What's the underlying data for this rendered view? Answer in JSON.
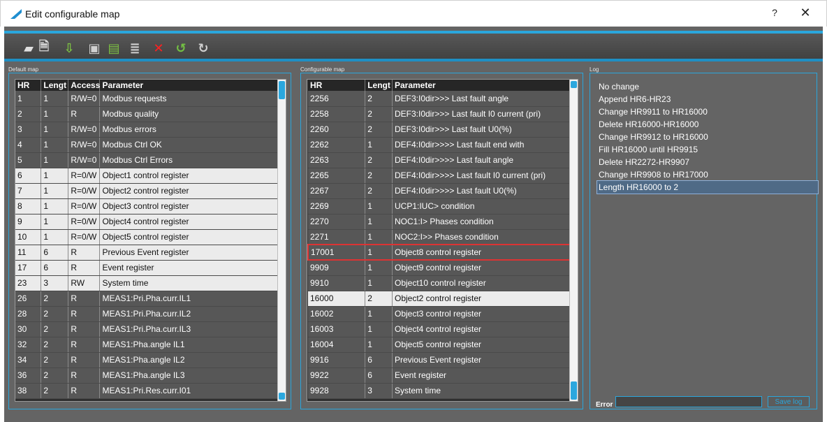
{
  "window": {
    "title": "Edit configurable map",
    "help_label": "?",
    "close_label": "✕"
  },
  "toolbar": {
    "buttons": [
      {
        "name": "open-folder-icon",
        "glyph": "▰",
        "color": "#e0e0e0"
      },
      {
        "name": "preview-document-icon",
        "glyph": "🗎",
        "color": "#d9d9d9"
      },
      {
        "name": "import-icon",
        "glyph": "⇩",
        "color": "#7cc043"
      },
      {
        "name": "save-icon",
        "glyph": "▣",
        "color": "#d0d0d0"
      },
      {
        "name": "export-icon",
        "glyph": "▤",
        "color": "#7cc043"
      },
      {
        "name": "list-icon",
        "glyph": "≣",
        "color": "#d0d0d0"
      },
      {
        "name": "delete-icon",
        "glyph": "✕",
        "color": "#ff2020"
      },
      {
        "name": "undo-icon",
        "glyph": "↺",
        "color": "#73c043"
      },
      {
        "name": "redo-icon",
        "glyph": "↻",
        "color": "#d0d0d0"
      }
    ]
  },
  "default_map": {
    "label": "Default map",
    "headers": [
      "HR",
      "Lengt",
      "Access",
      "Parameter"
    ],
    "rows": [
      [
        "1",
        "1",
        "R/W=0",
        "Modbus requests",
        "dark"
      ],
      [
        "2",
        "1",
        "R",
        "Modbus quality",
        "dark"
      ],
      [
        "3",
        "1",
        "R/W=0",
        "Modbus errors",
        "dark"
      ],
      [
        "4",
        "1",
        "R/W=0",
        "Modbus Ctrl OK",
        "dark"
      ],
      [
        "5",
        "1",
        "R/W=0",
        "Modbus Ctrl Errors",
        "dark"
      ],
      [
        "6",
        "1",
        "R=0/W",
        "Object1 control register",
        "light"
      ],
      [
        "7",
        "1",
        "R=0/W",
        "Object2 control register",
        "light"
      ],
      [
        "8",
        "1",
        "R=0/W",
        "Object3 control register",
        "light"
      ],
      [
        "9",
        "1",
        "R=0/W",
        "Object4 control register",
        "light"
      ],
      [
        "10",
        "1",
        "R=0/W",
        "Object5 control register",
        "light"
      ],
      [
        "11",
        "6",
        "R",
        "Previous Event register",
        "light"
      ],
      [
        "17",
        "6",
        "R",
        "Event register",
        "light"
      ],
      [
        "23",
        "3",
        "RW",
        "System time",
        "light"
      ],
      [
        "26",
        "2",
        "R",
        "MEAS1:Pri.Pha.curr.IL1",
        "dark"
      ],
      [
        "28",
        "2",
        "R",
        "MEAS1:Pri.Pha.curr.IL2",
        "dark"
      ],
      [
        "30",
        "2",
        "R",
        "MEAS1:Pri.Pha.curr.IL3",
        "dark"
      ],
      [
        "32",
        "2",
        "R",
        "MEAS1:Pha.angle IL1",
        "dark"
      ],
      [
        "34",
        "2",
        "R",
        "MEAS1:Pha.angle IL2",
        "dark"
      ],
      [
        "36",
        "2",
        "R",
        "MEAS1:Pha.angle IL3",
        "dark"
      ],
      [
        "38",
        "2",
        "R",
        "MEAS1:Pri.Res.curr.I01",
        "dark"
      ]
    ]
  },
  "configurable_map": {
    "label": "Configurable map",
    "headers": [
      "HR",
      "Lengt",
      "Parameter"
    ],
    "rows": [
      [
        "2256",
        "2",
        "DEF3:I0dir>>> Last fault angle",
        "dark"
      ],
      [
        "2258",
        "2",
        "DEF3:I0dir>>> Last fault I0 current (pri)",
        "dark"
      ],
      [
        "2260",
        "2",
        "DEF3:I0dir>>> Last fault U0(%)",
        "dark"
      ],
      [
        "2262",
        "1",
        "DEF4:I0dir>>>> Last fault end with",
        "dark"
      ],
      [
        "2263",
        "2",
        "DEF4:I0dir>>>> Last fault angle",
        "dark"
      ],
      [
        "2265",
        "2",
        "DEF4:I0dir>>>> Last fault I0 current (pri)",
        "dark"
      ],
      [
        "2267",
        "2",
        "DEF4:I0dir>>>> Last fault U0(%)",
        "dark"
      ],
      [
        "2269",
        "1",
        "UCP1:IUC> condition",
        "dark"
      ],
      [
        "2270",
        "1",
        "NOC1:I> Phases condition",
        "dark"
      ],
      [
        "2271",
        "1",
        "NOC2:I>> Phases condition",
        "dark"
      ],
      [
        "17001",
        "1",
        "Object8 control register",
        "selected"
      ],
      [
        "9909",
        "1",
        "Object9 control register",
        "dark"
      ],
      [
        "9910",
        "1",
        "Object10 control register",
        "dark"
      ],
      [
        "16000",
        "2",
        "Object2 control register",
        "light"
      ],
      [
        "16002",
        "1",
        "Object3 control register",
        "dark"
      ],
      [
        "16003",
        "1",
        "Object4 control register",
        "dark"
      ],
      [
        "16004",
        "1",
        "Object5 control register",
        "dark"
      ],
      [
        "9916",
        "6",
        "Previous Event register",
        "dark"
      ],
      [
        "9922",
        "6",
        "Event register",
        "dark"
      ],
      [
        "9928",
        "3",
        "System time",
        "dark"
      ]
    ]
  },
  "log": {
    "label": "Log",
    "entries": [
      "No change",
      "Append HR6-HR23",
      "Change HR9911 to HR16000",
      "Delete HR16000-HR16000",
      "Change HR9912 to HR16000",
      "Fill HR16000 until HR9915",
      "Delete HR2272-HR9907",
      "Change HR9908 to HR17000",
      "Length HR16000 to 2"
    ],
    "selected_index": 8,
    "error_label": "Error",
    "error_value": "",
    "save_label": "Save log"
  }
}
